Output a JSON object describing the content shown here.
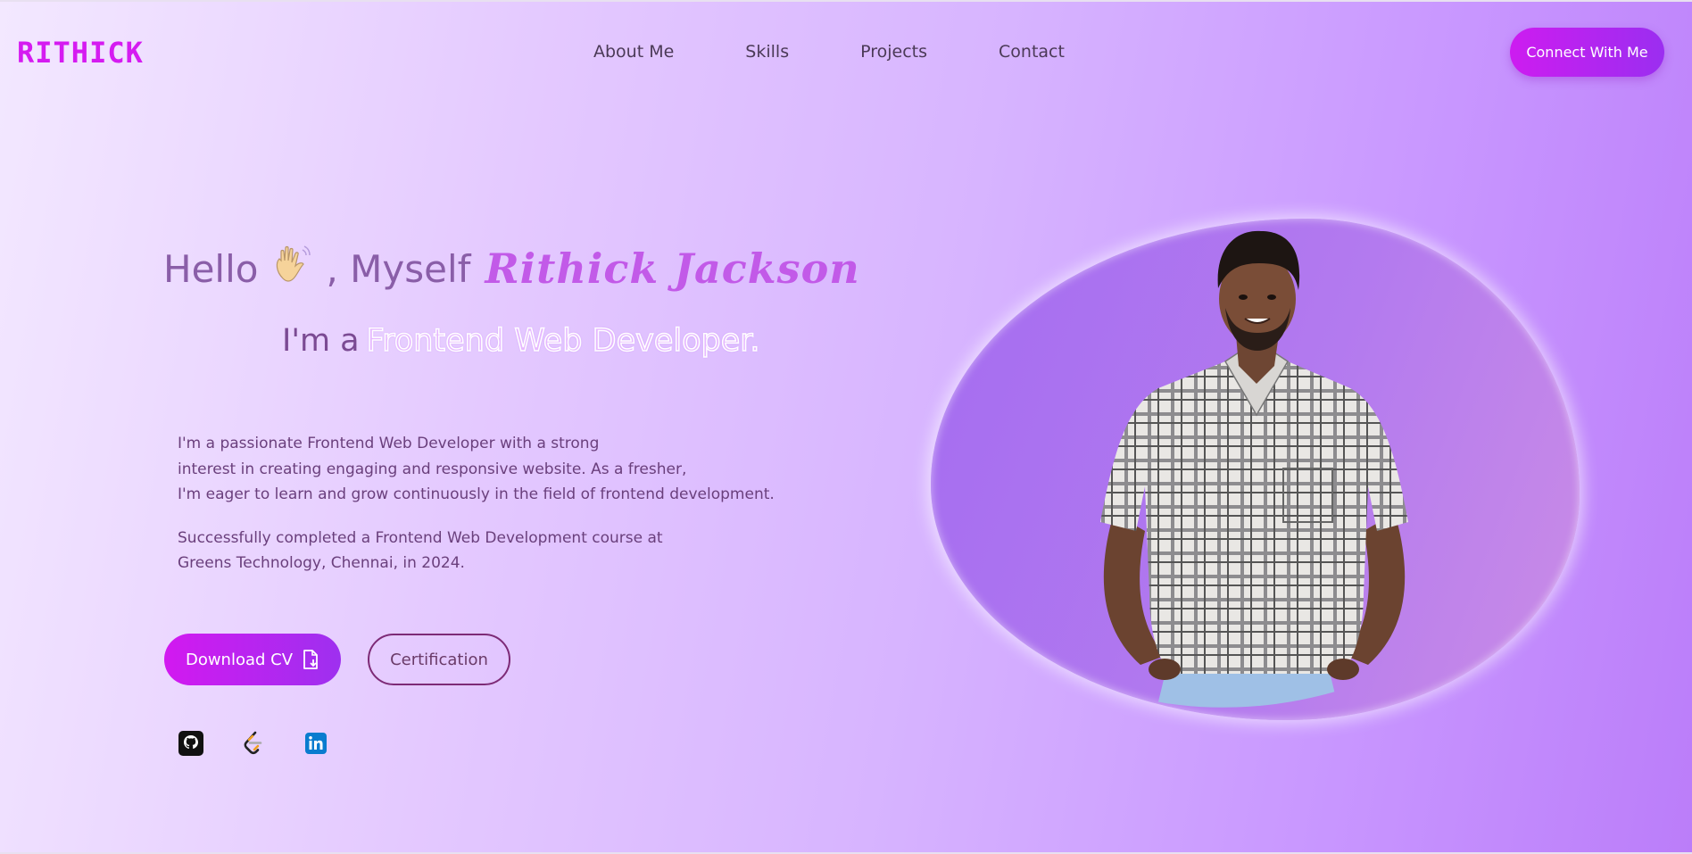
{
  "nav": {
    "logo": "RITHICK",
    "links": [
      "About Me",
      "Skills",
      "Projects",
      "Contact"
    ],
    "cta": "Connect With Me"
  },
  "hero": {
    "greeting_prefix": "Hello",
    "greeting_mid": ", Myself",
    "name": "Rithick Jackson",
    "role_prefix": "I'm a",
    "role_highlight": "Frontend Web Developer.",
    "bio_1_lines": [
      "I'm a passionate Frontend Web Developer with a strong",
      "interest in creating engaging and responsive website. As a fresher,",
      "I'm eager to learn and grow continuously in the field of frontend development."
    ],
    "bio_2_lines": [
      "Successfully completed a Frontend Web Development course at",
      "Greens Technology, Chennai, in 2024."
    ],
    "download_label": "Download CV",
    "certification_label": "Certification"
  },
  "icons": {
    "wave": "waving-hand-icon",
    "download": "file-download-icon",
    "socials": [
      "github-icon",
      "leetcode-icon",
      "linkedin-icon"
    ]
  },
  "colors": {
    "accent": "#d51bf1",
    "accent_2": "#9e30ef",
    "text_dark": "#4b3a57",
    "blob": "#a46cf0"
  }
}
